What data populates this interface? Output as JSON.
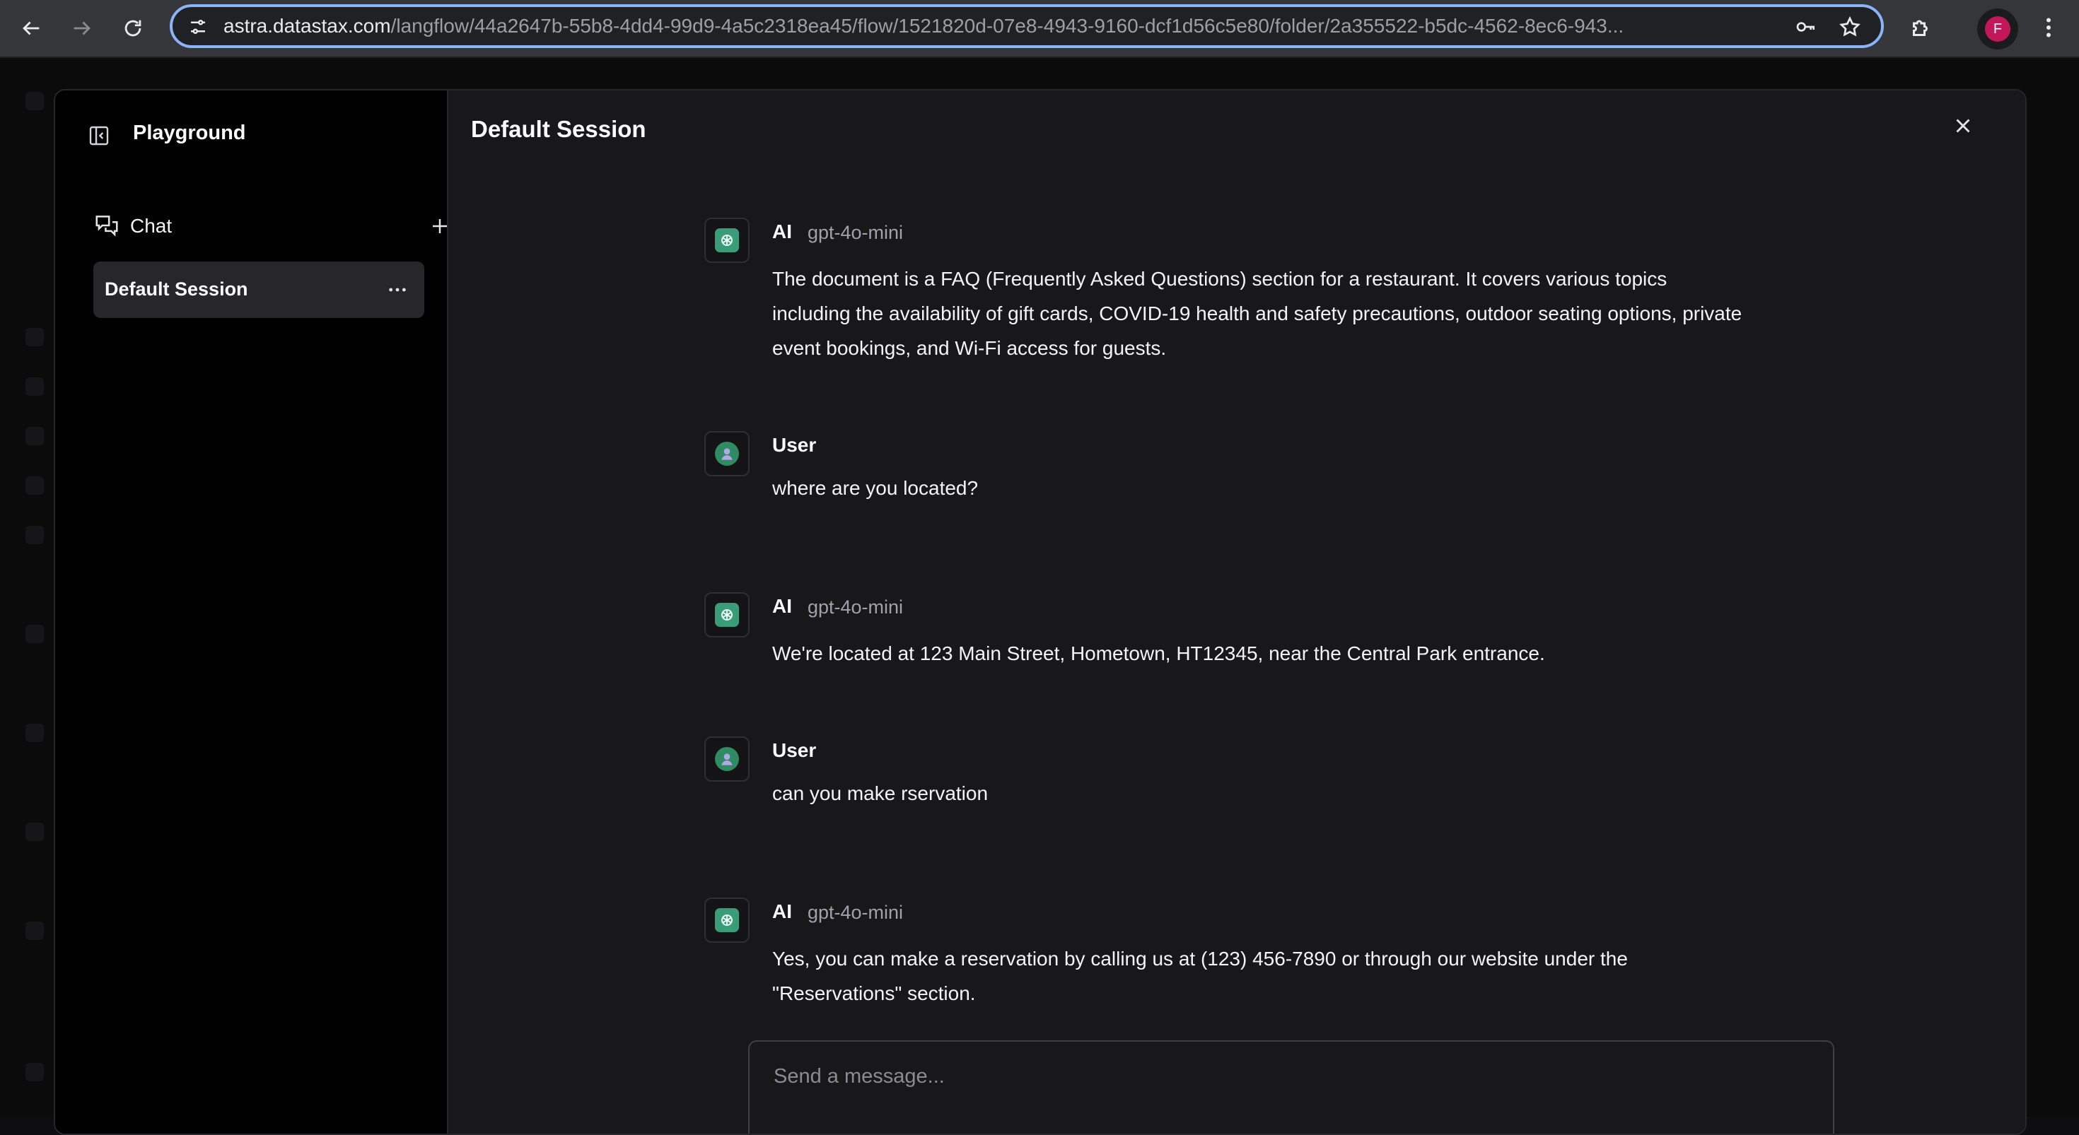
{
  "browser": {
    "url_host": "astra.datastax.com",
    "url_path": "/langflow/44a2647b-55b8-4dd4-99d9-4a5c2318ea45/flow/1521820d-07e8-4943-9160-dcf1d56c5e80/folder/2a355522-b5dc-4562-8ec6-943...",
    "profile_initial": "F"
  },
  "sidebar": {
    "title": "Playground",
    "chat_label": "Chat",
    "sessions": [
      {
        "label": "Default Session"
      }
    ]
  },
  "main": {
    "title": "Default Session",
    "messages": [
      {
        "sender": "AI",
        "model": "gpt-4o-mini",
        "text": "The document is a FAQ (Frequently Asked Questions) section for a restaurant. It covers various topics including the availability of gift cards, COVID-19 health and safety precautions, outdoor seating options, private event bookings, and Wi-Fi access for guests."
      },
      {
        "sender": "User",
        "text": "where are you located?"
      },
      {
        "sender": "AI",
        "model": "gpt-4o-mini",
        "text": "We're located at 123 Main Street, Hometown, HT12345, near the Central Park entrance."
      },
      {
        "sender": "User",
        "text": "can you make rservation"
      },
      {
        "sender": "AI",
        "model": "gpt-4o-mini",
        "text": "Yes, you can make a reservation by calling us at (123) 456-7890 or through our website under the \"Reservations\" section."
      }
    ],
    "input_placeholder": "Send a message..."
  },
  "colors": {
    "ai_badge": "#3a9c78",
    "user_badge": "#2e8b62",
    "omnibox_focus": "#8ab4f8",
    "profile": "#c2185b"
  }
}
